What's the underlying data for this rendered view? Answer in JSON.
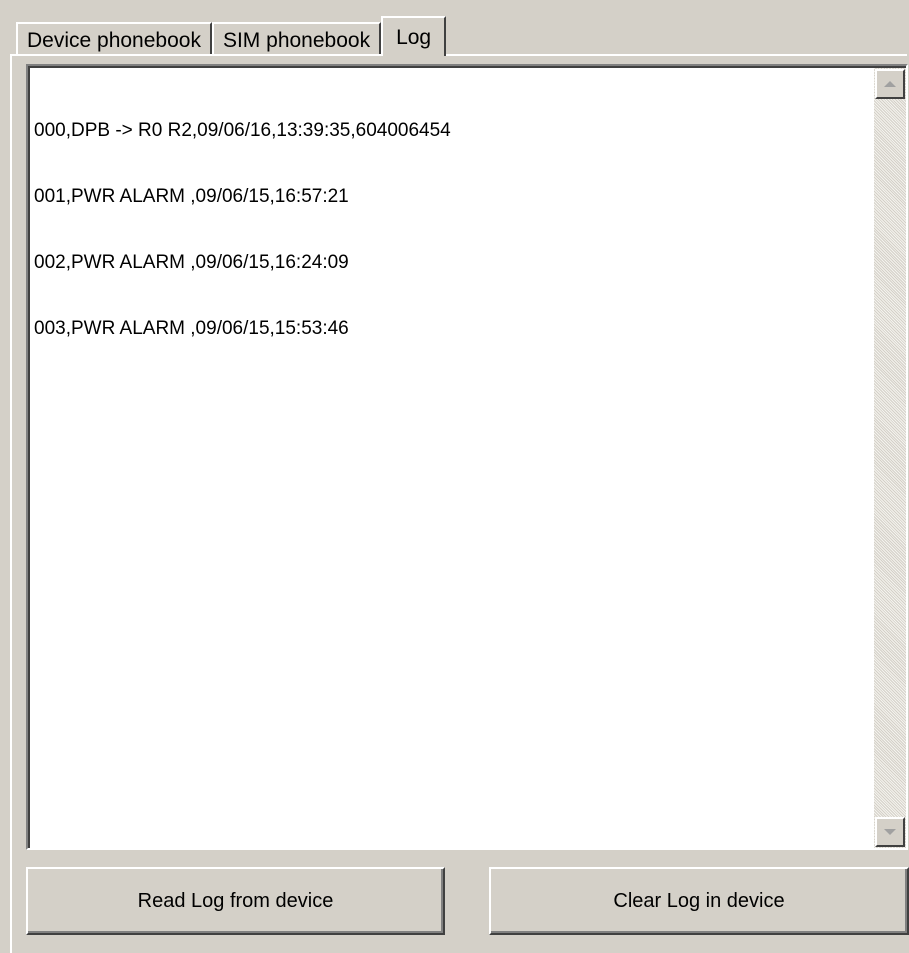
{
  "tabs": [
    {
      "label": "Device phonebook",
      "active": false
    },
    {
      "label": "SIM phonebook",
      "active": false
    },
    {
      "label": "Log",
      "active": true
    }
  ],
  "log": {
    "lines": [
      "000,DPB -> R0 R2,09/06/16,13:39:35,604006454",
      "001,PWR ALARM ,09/06/15,16:57:21",
      "002,PWR ALARM ,09/06/15,16:24:09",
      "003,PWR ALARM ,09/06/15,15:53:46"
    ]
  },
  "buttons": {
    "read_label": "Read Log from device",
    "clear_label": "Clear Log in device"
  },
  "icons": {
    "scroll_up": "scroll-up-arrow-icon",
    "scroll_down": "scroll-down-arrow-icon"
  },
  "colors": {
    "window_bg": "#d4d0c8",
    "memo_bg": "#ffffff"
  }
}
